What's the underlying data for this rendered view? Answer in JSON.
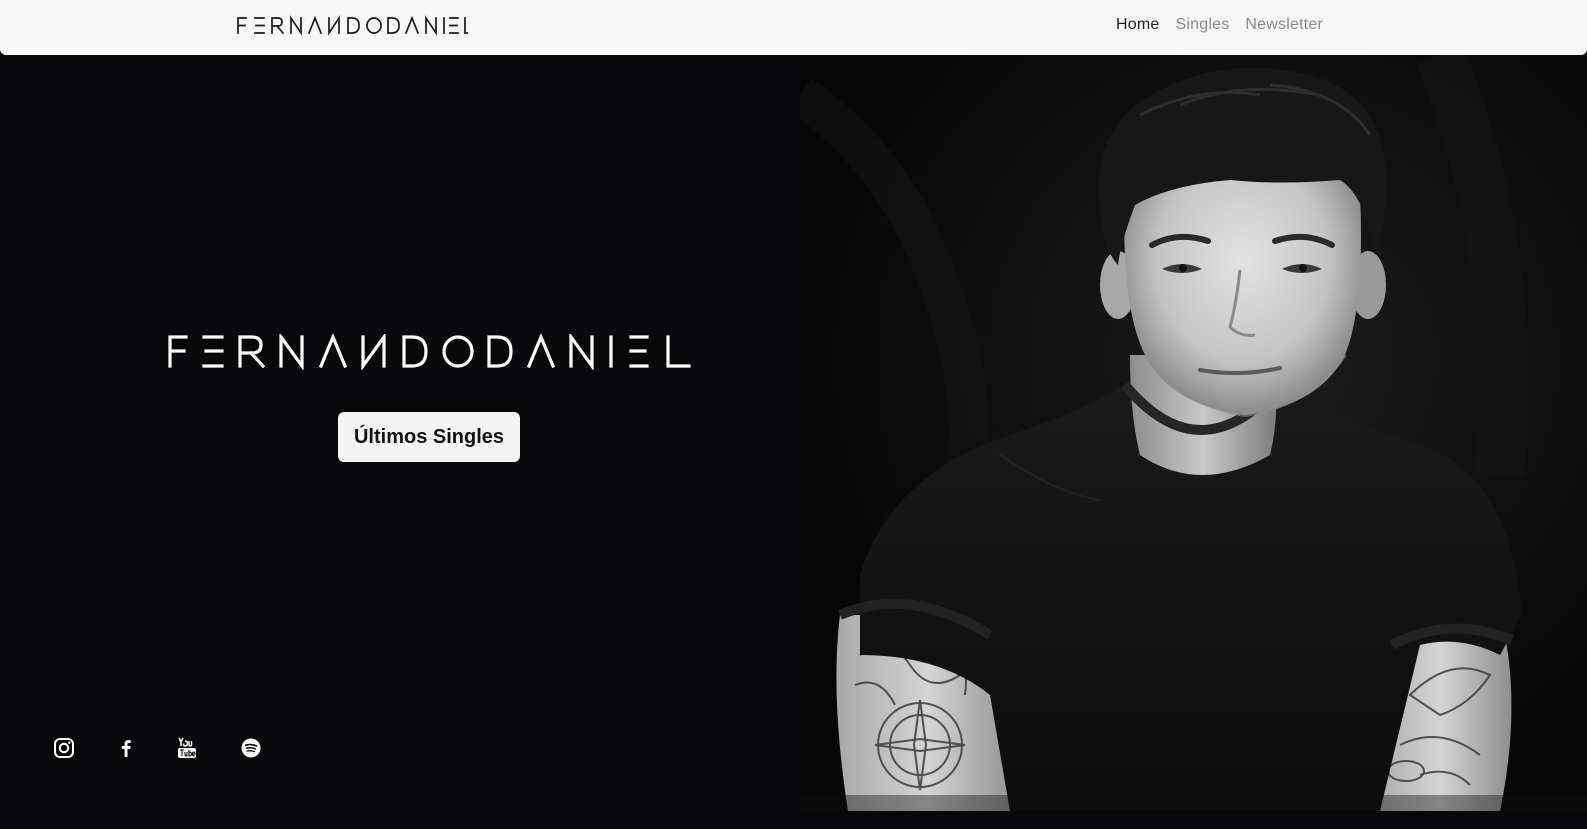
{
  "header": {
    "brand": "FERNANDODANIEL",
    "nav": [
      {
        "label": "Home",
        "active": true
      },
      {
        "label": "Singles",
        "active": false
      },
      {
        "label": "Newsletter",
        "active": false
      }
    ]
  },
  "hero": {
    "logo_text": "FERNANDODANIEL",
    "cta_label": "Últimos Singles",
    "photo_icon": "portrait-photo"
  },
  "social": [
    {
      "icon": "instagram-icon"
    },
    {
      "icon": "facebook-icon"
    },
    {
      "icon": "youtube-icon"
    },
    {
      "icon": "spotify-icon"
    }
  ],
  "colors": {
    "background": "#08080a",
    "navbar": "#f8f8f8",
    "nav_active": "#222222",
    "nav_inactive": "#8a8a8a",
    "button_bg": "#f4f4f4",
    "button_text": "#111111"
  }
}
